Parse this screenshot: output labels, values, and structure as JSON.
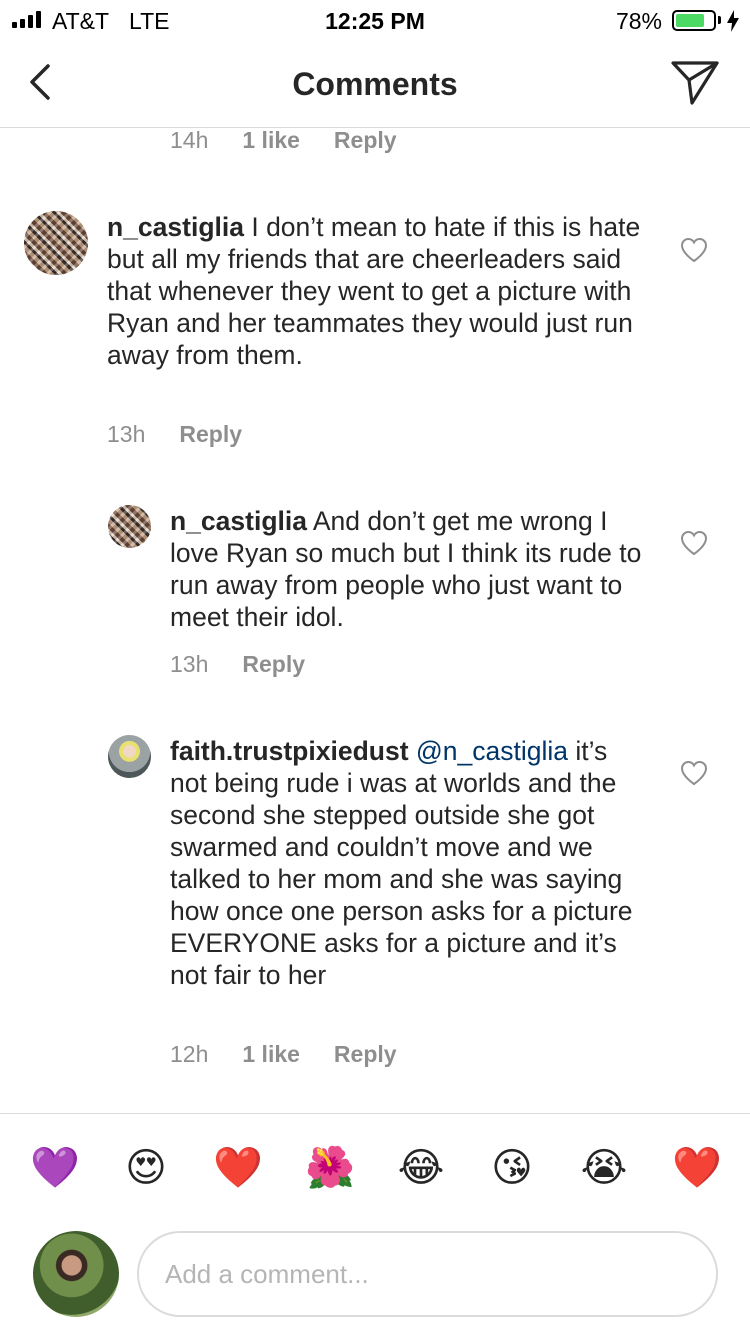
{
  "status_bar": {
    "carrier": "AT&T",
    "network": "LTE",
    "time": "12:25 PM",
    "battery_percent": "78%",
    "battery_level": 0.78
  },
  "nav": {
    "title": "Comments",
    "back_icon": "chevron-left-icon",
    "share_icon": "paper-plane-icon"
  },
  "comments": [
    {
      "time": "14h",
      "likes": "1 like",
      "reply_label": "Reply"
    },
    {
      "username": "n_castiglia",
      "text": " I don’t mean to hate if this is hate but all my friends that are cheerleaders said that whenever they went to get a picture with Ryan and her teammates they would just run away from them.",
      "time": "13h",
      "reply_label": "Reply"
    },
    {
      "username": "n_castiglia",
      "text": " And don’t get me wrong I love Ryan so much but I think its rude to run away from people who just want to meet their idol.",
      "time": "13h",
      "reply_label": "Reply"
    },
    {
      "username": "faith.trustpixiedust",
      "mention": "@n_castiglia",
      "text": " it’s not being rude i was at worlds and the second she stepped outside she got swarmed and couldn’t move and we talked to her mom and she was saying how once one person asks for a picture EVERYONE asks for a picture and it’s not fair to her",
      "time": "12h",
      "likes": "1 like",
      "reply_label": "Reply"
    }
  ],
  "emoji_bar": [
    "💜",
    "😍",
    "❤️",
    "🌺",
    "😂",
    "😘",
    "😭",
    "❤️"
  ],
  "composer": {
    "placeholder": "Add a comment..."
  },
  "colors": {
    "text": "#262626",
    "muted": "#8e8e8e",
    "mention": "#003569",
    "divider": "#dbdbdb",
    "battery": "#4cd964"
  }
}
